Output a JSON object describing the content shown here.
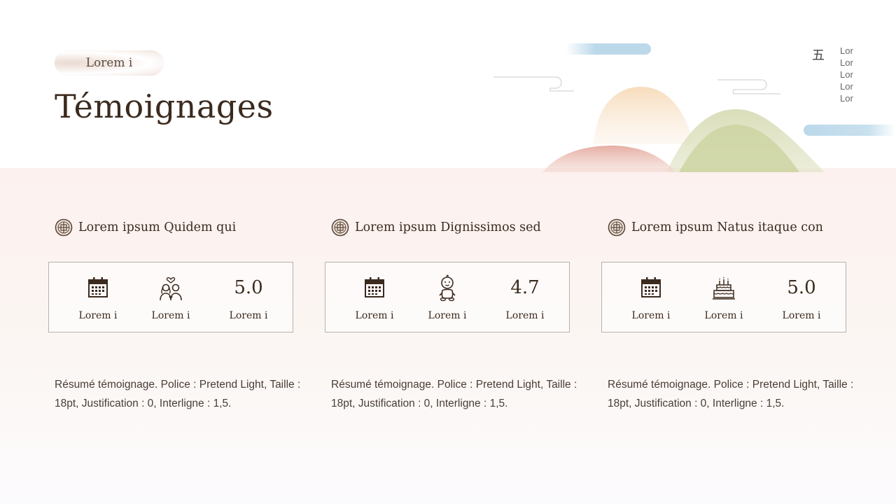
{
  "header": {
    "pill_label": "Lorem i",
    "title": "Témoignages"
  },
  "side": {
    "glyph": "五",
    "items": [
      "Lor",
      "Lor",
      "Lor",
      "Lor",
      "Lor"
    ]
  },
  "columns": [
    {
      "heading": "Lorem ipsum Quidem qui",
      "stats": [
        {
          "icon": "calendar-icon",
          "label": "Lorem i"
        },
        {
          "icon": "couple-heart-icon",
          "label": "Lorem i"
        },
        {
          "value": "5.0",
          "label": "Lorem i"
        }
      ],
      "summary": "Résumé témoignage. Police : Pretend Light, Taille : 18pt, Justification : 0, Interligne : 1,5."
    },
    {
      "heading": "Lorem ipsum Dignissimos sed",
      "stats": [
        {
          "icon": "calendar-icon",
          "label": "Lorem i"
        },
        {
          "icon": "baby-icon",
          "label": "Lorem i"
        },
        {
          "value": "4.7",
          "label": "Lorem i"
        }
      ],
      "summary": "Résumé témoignage. Police : Pretend Light, Taille : 18pt, Justification : 0, Interligne : 1,5."
    },
    {
      "heading": "Lorem ipsum Natus itaque con",
      "stats": [
        {
          "icon": "calendar-icon",
          "label": "Lorem i"
        },
        {
          "icon": "birthday-cake-icon",
          "label": "Lorem i"
        },
        {
          "value": "5.0",
          "label": "Lorem i"
        }
      ],
      "summary": "Résumé témoignage. Police : Pretend Light, Taille : 18pt, Justification : 0, Interligne : 1,5."
    }
  ],
  "colors": {
    "text": "#3b2a1e",
    "band": "#fcf1ef",
    "border": "#b9b1ab",
    "hill_green": "#cfd6a7",
    "hill_peach": "#f7e1c6",
    "hill_pink": "#e9b3aa",
    "cloud_blue": "#bcd9ea"
  }
}
